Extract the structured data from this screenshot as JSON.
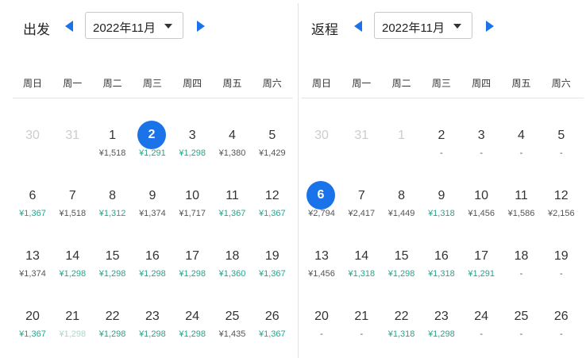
{
  "colors": {
    "accent": "#1a73e8",
    "low_price": "#23a58a",
    "normal_price": "#555555",
    "out_of_month": "#cccccc"
  },
  "weekdays": [
    "周日",
    "周一",
    "周二",
    "周三",
    "周四",
    "周五",
    "周六"
  ],
  "depart": {
    "label": "出发",
    "month_value": "2022年11月",
    "prev_icon": "triangle-left-icon",
    "next_icon": "triangle-right-icon",
    "weeks": [
      [
        {
          "day": "30",
          "price": "",
          "tone": "grey"
        },
        {
          "day": "31",
          "price": "",
          "tone": "grey"
        },
        {
          "day": "1",
          "price": "¥1,518",
          "tone": "normal"
        },
        {
          "day": "2",
          "price": "¥1,291",
          "tone": "green",
          "selected": true
        },
        {
          "day": "3",
          "price": "¥1,298",
          "tone": "green"
        },
        {
          "day": "4",
          "price": "¥1,380",
          "tone": "normal"
        },
        {
          "day": "5",
          "price": "¥1,429",
          "tone": "normal"
        }
      ],
      [
        {
          "day": "6",
          "price": "¥1,367",
          "tone": "green"
        },
        {
          "day": "7",
          "price": "¥1,518",
          "tone": "normal"
        },
        {
          "day": "8",
          "price": "¥1,312",
          "tone": "green"
        },
        {
          "day": "9",
          "price": "¥1,374",
          "tone": "normal"
        },
        {
          "day": "10",
          "price": "¥1,717",
          "tone": "normal"
        },
        {
          "day": "11",
          "price": "¥1,367",
          "tone": "green"
        },
        {
          "day": "12",
          "price": "¥1,367",
          "tone": "green"
        }
      ],
      [
        {
          "day": "13",
          "price": "¥1,374",
          "tone": "normal"
        },
        {
          "day": "14",
          "price": "¥1,298",
          "tone": "green"
        },
        {
          "day": "15",
          "price": "¥1,298",
          "tone": "green"
        },
        {
          "day": "16",
          "price": "¥1,298",
          "tone": "green"
        },
        {
          "day": "17",
          "price": "¥1,298",
          "tone": "green"
        },
        {
          "day": "18",
          "price": "¥1,360",
          "tone": "green"
        },
        {
          "day": "19",
          "price": "¥1,367",
          "tone": "green"
        }
      ],
      [
        {
          "day": "20",
          "price": "¥1,367",
          "tone": "green"
        },
        {
          "day": "21",
          "price": "¥1,298",
          "tone": "faded"
        },
        {
          "day": "22",
          "price": "¥1,298",
          "tone": "green"
        },
        {
          "day": "23",
          "price": "¥1,298",
          "tone": "green"
        },
        {
          "day": "24",
          "price": "¥1,298",
          "tone": "green"
        },
        {
          "day": "25",
          "price": "¥1,435",
          "tone": "normal"
        },
        {
          "day": "26",
          "price": "¥1,367",
          "tone": "green"
        }
      ]
    ]
  },
  "return": {
    "label": "返程",
    "month_value": "2022年11月",
    "prev_icon": "triangle-left-icon",
    "next_icon": "triangle-right-icon",
    "weeks": [
      [
        {
          "day": "30",
          "price": "",
          "tone": "grey"
        },
        {
          "day": "31",
          "price": "",
          "tone": "grey"
        },
        {
          "day": "1",
          "price": "",
          "tone": "grey"
        },
        {
          "day": "2",
          "price": "-",
          "tone": "normal"
        },
        {
          "day": "3",
          "price": "-",
          "tone": "normal"
        },
        {
          "day": "4",
          "price": "-",
          "tone": "normal"
        },
        {
          "day": "5",
          "price": "-",
          "tone": "normal"
        }
      ],
      [
        {
          "day": "6",
          "price": "¥2,794",
          "tone": "normal",
          "selected": true
        },
        {
          "day": "7",
          "price": "¥2,417",
          "tone": "normal"
        },
        {
          "day": "8",
          "price": "¥1,449",
          "tone": "normal"
        },
        {
          "day": "9",
          "price": "¥1,318",
          "tone": "green"
        },
        {
          "day": "10",
          "price": "¥1,456",
          "tone": "normal"
        },
        {
          "day": "11",
          "price": "¥1,586",
          "tone": "normal"
        },
        {
          "day": "12",
          "price": "¥2,156",
          "tone": "normal"
        }
      ],
      [
        {
          "day": "13",
          "price": "¥1,456",
          "tone": "normal"
        },
        {
          "day": "14",
          "price": "¥1,318",
          "tone": "green"
        },
        {
          "day": "15",
          "price": "¥1,298",
          "tone": "green"
        },
        {
          "day": "16",
          "price": "¥1,318",
          "tone": "green"
        },
        {
          "day": "17",
          "price": "¥1,291",
          "tone": "green"
        },
        {
          "day": "18",
          "price": "-",
          "tone": "normal"
        },
        {
          "day": "19",
          "price": "-",
          "tone": "normal"
        }
      ],
      [
        {
          "day": "20",
          "price": "-",
          "tone": "normal"
        },
        {
          "day": "21",
          "price": "-",
          "tone": "normal"
        },
        {
          "day": "22",
          "price": "¥1,318",
          "tone": "green"
        },
        {
          "day": "23",
          "price": "¥1,298",
          "tone": "green"
        },
        {
          "day": "24",
          "price": "-",
          "tone": "normal"
        },
        {
          "day": "25",
          "price": "-",
          "tone": "normal"
        },
        {
          "day": "26",
          "price": "-",
          "tone": "normal"
        }
      ]
    ]
  }
}
